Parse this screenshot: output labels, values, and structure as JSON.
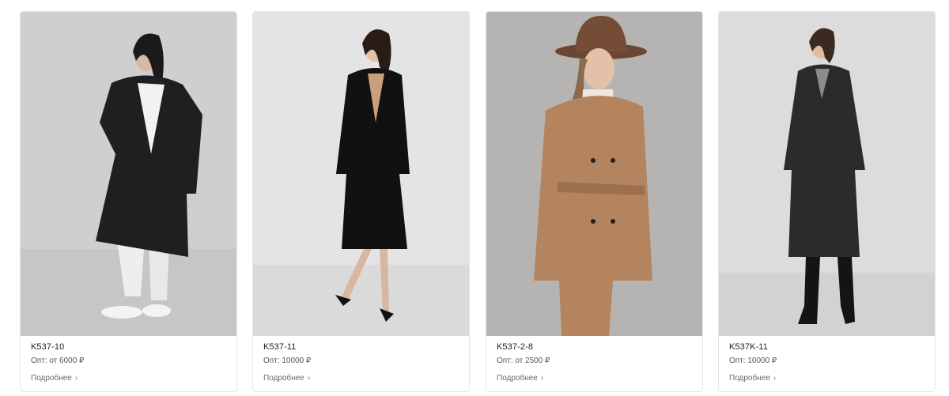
{
  "products": [
    {
      "sku": "K537-10",
      "price": "Опт: от 6000 ₽",
      "more": "Подробнее",
      "coat_color": "#1e1f21",
      "bg": "#cfcfcf"
    },
    {
      "sku": "K537-11",
      "price": "Опт: 10000 ₽",
      "more": "Подробнее",
      "coat_color": "#111111",
      "bg": "#e4e4e4"
    },
    {
      "sku": "K537-2-8",
      "price": "Опт: от 2500 ₽",
      "more": "Подробнее",
      "coat_color": "#b4845f",
      "bg": "#b6b4b2"
    },
    {
      "sku": "K537K-11",
      "price": "Опт: 10000 ₽",
      "more": "Подробнее",
      "coat_color": "#2b2b2b",
      "bg": "#dcdcdc"
    }
  ],
  "icons": {
    "more_chevron": "chevron-right-icon"
  }
}
